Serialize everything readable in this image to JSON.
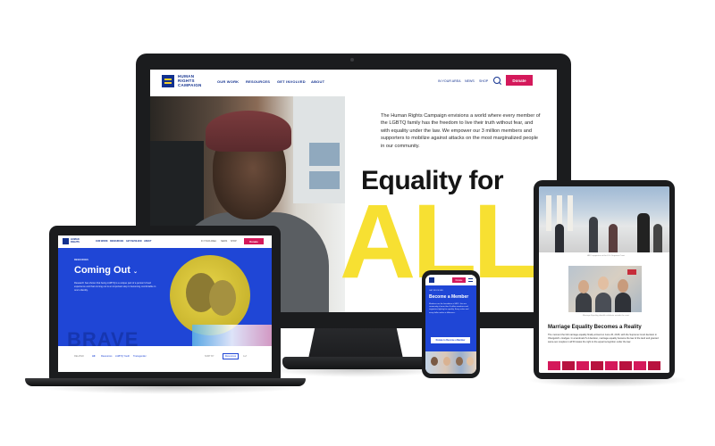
{
  "brand": {
    "logo_line1": "HUMAN",
    "logo_line2": "RIGHTS",
    "logo_line3": "CAMPAIGN",
    "accent": "#d4195b",
    "primary": "#12318f",
    "hero_blue": "#1f46d6",
    "yellow": "#f7e032"
  },
  "desktop": {
    "nav": {
      "items": [
        "OUR WORK",
        "RESOURCES",
        "GET INVOLVED",
        "ABOUT"
      ],
      "right_items": [
        "IN YOUR AREA",
        "NEWS",
        "SHOP"
      ],
      "search_icon": "search-icon",
      "donate_label": "Donate"
    },
    "mission": "The Human Rights Campaign envisions a world where every member of the LGBTQ family has the freedom to live their truth without fear, and with equality under the law. We empower our 3 million members and supporters to mobilize against attacks on the most marginalized people in our community.",
    "headline": "Equality for",
    "headline_big": "ALL"
  },
  "laptop": {
    "nav": {
      "items": [
        "OUR WORK",
        "RESOURCES",
        "GET INVOLVED",
        "ABOUT"
      ],
      "right_items": [
        "IN YOUR AREA",
        "NEWS",
        "SHOP"
      ],
      "donate_label": "Donate"
    },
    "kicker": "RESOURCES",
    "title": "Coming Out",
    "description": "Research has shown that being LGBTQ is a unique part of a person's lived experience and that coming out is an important step in becoming comfortable in one's identity.",
    "banner_word": "BRAVE",
    "crumbs_label": "RELATED",
    "crumbs": [
      "All",
      "Resources",
      "LGBTQ Youth",
      "Transgender"
    ],
    "filter_label": "SORT BY",
    "resources_button": "Resources",
    "az_label": "A-Z"
  },
  "phone": {
    "donate_label": "Donate",
    "kicker": "GET INVOLVED",
    "title": "Become a Member",
    "text": "Members are the foundation of HRC. Join our community of more than 3 million members and supporters fighting for equality. Every action and every dollar makes a difference.",
    "button_label": "Donate to Become a Member"
  },
  "tablet": {
    "caption1": "HRC supporters at the U.S. Supreme Court",
    "caption2": "Marriage Equality plaintiffs celebrate outside the court",
    "heading": "Marriage Equality Becomes a Reality",
    "body": "The moment the full marriage equality finally arrived on June 26, 2015, with the Supreme Court decision in Obergefell v. Hodges. In a landmark 5-4 decision, marriage equality became the law of the land and granted same-sex couples in all 50 states the right to the equal recognition under the law."
  }
}
